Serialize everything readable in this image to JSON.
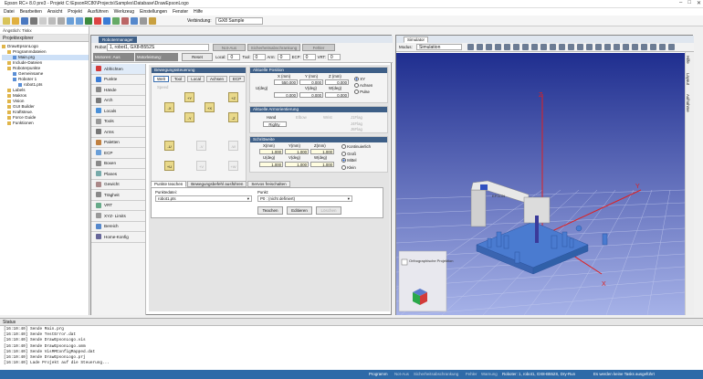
{
  "window": {
    "title": "Epson RC+ 8.0 pre3 - Projekt C:\\EpsonRC80\\Projects\\Samples\\Database\\DrawEpsonLogo"
  },
  "menu": [
    "Datei",
    "Bearbeiten",
    "Ansicht",
    "Projekt",
    "Ausführen",
    "Werkzeug",
    "Einstellungen",
    "Fenster",
    "Hilfe"
  ],
  "toolbar": {
    "connection_label": "Verbindung:",
    "connection_value": "GX8 Sample"
  },
  "toolbar2": {
    "label": "Ängstlich: Tiskx"
  },
  "project_explorer": {
    "title": "Projektexplorer",
    "items": [
      {
        "label": "DrawEpsonLogo",
        "indent": 0
      },
      {
        "label": "Programmdateien",
        "indent": 1
      },
      {
        "label": "Main.prg",
        "indent": 2,
        "selected": true
      },
      {
        "label": "Include-Dateien",
        "indent": 1
      },
      {
        "label": "Roboterpunkte",
        "indent": 1
      },
      {
        "label": "Gemeinsame",
        "indent": 2
      },
      {
        "label": "Roboter 1",
        "indent": 2
      },
      {
        "label": "robot1.pts",
        "indent": 3
      },
      {
        "label": "Labels",
        "indent": 1
      },
      {
        "label": "Makros",
        "indent": 1
      },
      {
        "label": "Vision",
        "indent": 1
      },
      {
        "label": "GUI Builder",
        "indent": 1
      },
      {
        "label": "Kraftsteue.",
        "indent": 1
      },
      {
        "label": "Force Guide",
        "indent": 1
      },
      {
        "label": "Funktionen",
        "indent": 1
      }
    ]
  },
  "robot_manager": {
    "tab": "Robotermanager",
    "top_buttons": [
      "Not-Aus",
      "Sicherheitsabschrankung",
      "Fehler"
    ],
    "robot_label": "Robot:",
    "robot_value": "1, robot1, GX8-B552S",
    "motors_label": "Motoren: Aus",
    "power_label": "Motorleistung: Reduziert",
    "reset": "Reset",
    "local_label": "Local:",
    "local_val": "0",
    "tool_label": "Tool:",
    "tool_val": "0",
    "arm_label": "Arm:",
    "arm_val": "0",
    "ecp_label": "ECP:",
    "ecp_val": "0",
    "vrt_label": "VRT:",
    "vrt_val": "0",
    "left_items": [
      "Abfrichten",
      "Punkte",
      "Hände",
      "Arch",
      "Locals",
      "Tools",
      "Arms",
      "Paletten",
      "ECP",
      "Boxen",
      "Planes",
      "Gewicht",
      "Trägheit",
      "VRT",
      "XYZ- Limits",
      "Bereich",
      "Home-Konfig"
    ],
    "jog": {
      "title": "Bewegungssteuerung",
      "tabs": [
        "Welt",
        "Tool",
        "Local",
        "Achsen",
        "ECP"
      ],
      "speed_label": "Speed",
      "buttons": [
        "-X",
        "+X",
        "-Y",
        "+Y",
        "+Z",
        "-Z",
        "-U",
        "+U",
        "-V",
        "+V",
        "-W",
        "+W"
      ]
    },
    "position": {
      "title": "Aktuelle Position",
      "cols": [
        "X (mm)",
        "Y (mm)",
        "Z (mm)"
      ],
      "row1": [
        "550.000",
        "0.000",
        "0.000"
      ],
      "row2_label": "U(deg)",
      "cols2": [
        "V(deg)",
        "W(deg)"
      ],
      "row2": [
        "0.000",
        "0.000",
        "0.000"
      ],
      "radios": [
        "XY",
        "Achsen",
        "Pulse"
      ]
    },
    "orientation": {
      "title": "Aktuelle Armorientierung",
      "hand_label": "Hand",
      "hand_val": "Righty",
      "elbow": "Elbow",
      "wrist": "Wrist",
      "j1flag": "J1Flag",
      "j4flag": "J4Flag",
      "j6flag": "J6Flag"
    },
    "step": {
      "title": "Schrittweite",
      "cols": [
        "X(mm)",
        "Y(mm)",
        "Z(mm)"
      ],
      "row1": [
        "1.000",
        "1.000",
        "1.000"
      ],
      "cols2": [
        "U(deg)",
        "V(deg)",
        "W(deg)"
      ],
      "row2": [
        "1.000",
        "1.000",
        "1.000"
      ],
      "radios": [
        "Kontinuierlich",
        "Groß",
        "Mittel",
        "Klein"
      ]
    },
    "bottom_tabs": [
      "Punkte teachen",
      "Bewegungsbefehl ausführen",
      "Servos freischalten"
    ],
    "points_file_label": "Punktedatei:",
    "points_file": "robot1.pts",
    "point_label": "Punkt:",
    "point": "P0 : (nicht definiert)",
    "btn_teach": "Teachen",
    "btn_edit": "Editieren",
    "btn_delete": "Löschen"
  },
  "simulator": {
    "tab": "Simulator",
    "mode_label": "Modus:",
    "mode_value": "Simulation",
    "ortho_label": "Orthographische Projektion",
    "right_tabs": [
      "Hilfe",
      "Layout",
      "Aufnahme"
    ],
    "axes": {
      "x": "X",
      "y": "Y",
      "z": "Z"
    },
    "logo": "EPSON"
  },
  "status": {
    "title": "Status",
    "lines": [
      "[16:10:40]  Sende Main.prg",
      "[16:10:40]  Sende TestError.dat",
      "[16:10:40]  Sende DrawEpsonLogo.vis",
      "[16:10:40]  Sende DrawEpsonLogo.xmm",
      "[16:10:40]  Sende VisMMConfigMapped.dat",
      "[16:10:40]  Sende DrawEpsonLogo.prj",
      "[16:10:40]  Lade Projekt auf die Steuerung..."
    ]
  },
  "statusbar": {
    "items": [
      "Programm",
      "Not-Aus",
      "Sicherheitsabschrankung",
      "Fehler",
      "Warnung",
      "Roboter: 1, robot1, GX8-B552S, Dry-Run"
    ],
    "right": "Es werden keine Tasks ausgeführt"
  }
}
